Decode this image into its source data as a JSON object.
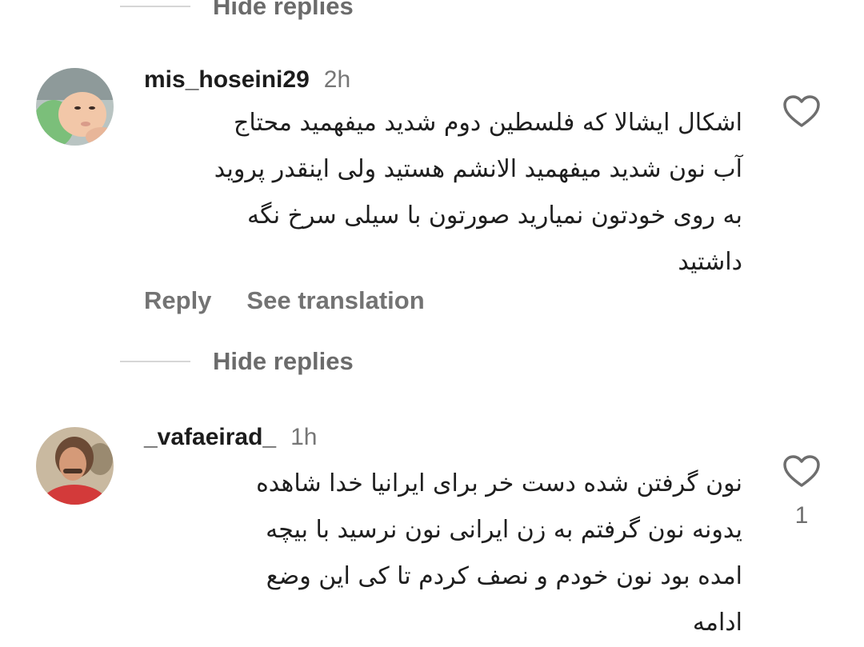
{
  "top_hide_replies": {
    "label": "Hide replies"
  },
  "comment1": {
    "username": "mis_hoseini29",
    "time": "2h",
    "lines": [
      "اشکال ایشالا که فلسطین دوم شدید میفهمید محتاج",
      "آب نون شدید میفهمید الانشم هستید ولی اینقدر پروید",
      "به روی خودتون نمیارید صورتون با سیلی سرخ نگه",
      "داشتید"
    ],
    "reply_label": "Reply",
    "translation_label": "See translation",
    "icons": {
      "like": "heart-outline-icon"
    }
  },
  "mid_hide_replies": {
    "label": "Hide replies"
  },
  "comment2": {
    "username": "_vafaeirad_",
    "time": "1h",
    "lines": [
      "نون گرفتن شده دست خر برای ایرانیا خدا شاهده",
      "یدونه نون گرفتم به زن ایرانی نون نرسید با بیچه",
      "امده بود نون خودم و نصف کردم تا کی این وضع",
      "ادامه"
    ],
    "like_count": "1",
    "icons": {
      "like": "heart-outline-icon"
    }
  },
  "colors": {
    "secondary_text": "#737373",
    "primary_text": "#1a1a1a",
    "divider": "#d6d6d6"
  }
}
